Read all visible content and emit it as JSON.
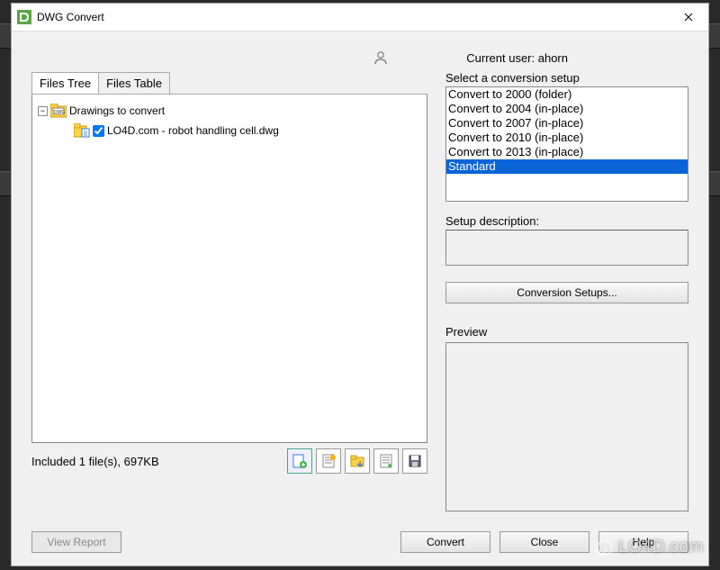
{
  "window": {
    "title": "DWG Convert"
  },
  "current_user_label": "Current user: ahorn",
  "tabs": {
    "files_tree": "Files Tree",
    "files_table": "Files Table"
  },
  "tree": {
    "root_label": "Drawings to convert",
    "file_label": "LO4D.com - robot handling cell.dwg"
  },
  "included_text": "Included 1 file(s), 697KB",
  "setup_section_label": "Select a conversion setup",
  "setups": [
    "Convert to 2000 (folder)",
    "Convert to 2004 (in-place)",
    "Convert to 2007 (in-place)",
    "Convert to 2010 (in-place)",
    "Convert to 2013 (in-place)",
    "Standard"
  ],
  "setup_selected_index": 5,
  "desc_label": "Setup description:",
  "conversion_setups_btn": "Conversion Setups...",
  "preview_label": "Preview",
  "buttons": {
    "view_report": "View Report",
    "convert": "Convert",
    "close": "Close",
    "help": "Help"
  },
  "watermark": "LO4D.com"
}
